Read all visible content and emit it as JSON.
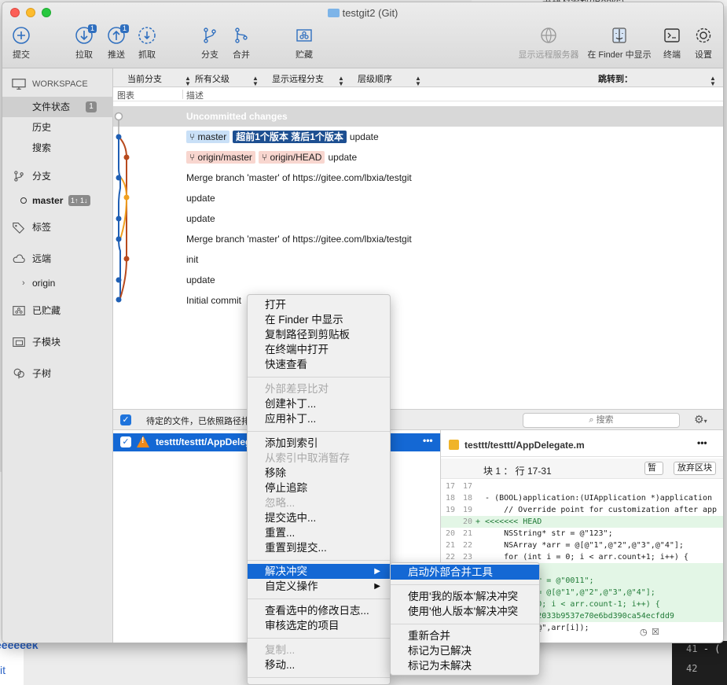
{
  "window": {
    "title": "testgit2 (Git)"
  },
  "background": {
    "top_text": "书籍及资料(iBooks)",
    "left_text": "eeeeeek",
    "left_text2": "it",
    "right_lines": [
      "41",
      "42"
    ],
    "right_char": "- (",
    "left_char": "a"
  },
  "toolbar": {
    "commit": "提交",
    "pull": "拉取",
    "push": "推送",
    "fetch": "抓取",
    "branch": "分支",
    "merge": "合并",
    "stash": "贮藏",
    "show_remote": "显示远程服务器",
    "show_in_finder": "在 Finder 中显示",
    "terminal": "终端",
    "settings": "设置",
    "pull_badge": "1",
    "push_badge": "1"
  },
  "sidebar": {
    "workspace": "WORKSPACE",
    "file_status": "文件状态",
    "file_status_count": "1",
    "history": "历史",
    "search": "搜索",
    "branches": "分支",
    "master": "master",
    "master_badge": "1↑ 1↓",
    "tags": "标签",
    "remotes": "远端",
    "origin": "origin",
    "stashes": "已贮藏",
    "submodules": "子模块",
    "subtrees": "子树"
  },
  "filterbar": {
    "current_branch": "当前分支",
    "all_parents": "所有父级",
    "show_remote_branches": "显示远程分支",
    "ancestor_order": "层级顺序",
    "jump_to": "跳转到："
  },
  "columns": {
    "graph": "图表",
    "description": "描述"
  },
  "commits": [
    {
      "text": "Uncommitted changes",
      "tags": []
    },
    {
      "text": "update",
      "tags": [
        {
          "label": "master",
          "kind": "local"
        },
        {
          "label": "超前1个版本 落后1个版本",
          "kind": "status"
        }
      ]
    },
    {
      "text": "update",
      "tags": [
        {
          "label": "origin/master",
          "kind": "remote"
        },
        {
          "label": "origin/HEAD",
          "kind": "remote"
        }
      ]
    },
    {
      "text": "Merge branch 'master' of https://gitee.com/lbxia/testgit",
      "tags": []
    },
    {
      "text": "update",
      "tags": []
    },
    {
      "text": "update",
      "tags": []
    },
    {
      "text": "Merge branch 'master' of https://gitee.com/lbxia/testgit",
      "tags": []
    },
    {
      "text": "init",
      "tags": []
    },
    {
      "text": "update",
      "tags": []
    },
    {
      "text": "Initial commit",
      "tags": []
    }
  ],
  "staged": {
    "label": "待定的文件，已依照路径排",
    "search_placeholder": "搜索"
  },
  "file": {
    "name": "testtt/testtt/AppDelega"
  },
  "diff": {
    "file": "testtt/testtt/AppDelegate.m",
    "hunk": "块 1 ： 行 17-31",
    "stage_btn": "暂存",
    "discard_btn": "放弃区块",
    "lines": [
      {
        "a": "17",
        "b": "17",
        "t": "",
        "k": "ctx"
      },
      {
        "a": "18",
        "b": "18",
        "t": "  - (BOOL)application:(UIApplication *)application",
        "k": "ctx"
      },
      {
        "a": "19",
        "b": "19",
        "t": "      // Override point for customization after app",
        "k": "ctx"
      },
      {
        "a": "",
        "b": "20",
        "t": "+ <<<<<<< HEAD",
        "k": "add"
      },
      {
        "a": "20",
        "b": "21",
        "t": "      NSString* str = @\"123\";",
        "k": "ctx"
      },
      {
        "a": "21",
        "b": "22",
        "t": "      NSArray *arr = @[@\"1\",@\"2\",@\"3\",@\"4\"];",
        "k": "ctx"
      },
      {
        "a": "22",
        "b": "23",
        "t": "      for (int i = 0; i < arr.count+1; i++) {",
        "k": "ctx"
      },
      {
        "a": "",
        "b": "",
        "t": "",
        "k": "add"
      },
      {
        "a": "",
        "b": "",
        "t": "      ing* str = @\"0011\";",
        "k": "add"
      },
      {
        "a": "",
        "b": "",
        "t": "      y *arr = @[@\"1\",@\"2\",@\"3\",@\"4\"];",
        "k": "add"
      },
      {
        "a": "",
        "b": "",
        "t": "      nt i = 0; i < arr.count-1; i++) {",
        "k": "add"
      },
      {
        "a": "",
        "b": "",
        "t": "    0214019b12033b9537e70e6bd390ca54ecfdd9",
        "k": "add"
      },
      {
        "a": "",
        "b": "",
        "t": "      Log(@\"%@\",arr[i]);",
        "k": "ctx"
      }
    ]
  },
  "context_menu": [
    {
      "label": "打开",
      "state": "normal"
    },
    {
      "label": "在 Finder 中显示",
      "state": "normal"
    },
    {
      "label": "复制路径到剪贴板",
      "state": "normal"
    },
    {
      "label": "在终端中打开",
      "state": "normal"
    },
    {
      "label": "快速查看",
      "state": "normal"
    },
    {
      "label": "外部差异比对",
      "state": "disabled"
    },
    {
      "label": "创建补丁...",
      "state": "normal"
    },
    {
      "label": "应用补丁...",
      "state": "normal"
    },
    {
      "label": "添加到索引",
      "state": "normal"
    },
    {
      "label": "从索引中取消暂存",
      "state": "disabled"
    },
    {
      "label": "移除",
      "state": "normal"
    },
    {
      "label": "停止追踪",
      "state": "normal"
    },
    {
      "label": "忽略...",
      "state": "disabled"
    },
    {
      "label": "提交选中...",
      "state": "normal"
    },
    {
      "label": "重置...",
      "state": "normal"
    },
    {
      "label": "重置到提交...",
      "state": "normal"
    },
    {
      "label": "解决冲突",
      "state": "selected"
    },
    {
      "label": "自定义操作",
      "state": "normal"
    },
    {
      "label": "查看选中的修改日志...",
      "state": "normal"
    },
    {
      "label": "审核选定的项目",
      "state": "normal"
    },
    {
      "label": "复制...",
      "state": "disabled"
    },
    {
      "label": "移动...",
      "state": "normal"
    }
  ],
  "submenu": [
    {
      "label": "启动外部合并工具",
      "state": "selected"
    },
    {
      "label": "使用'我的版本'解决冲突",
      "state": "normal"
    },
    {
      "label": "使用'他人版本'解决冲突",
      "state": "normal"
    },
    {
      "label": "重新合并",
      "state": "normal"
    },
    {
      "label": "标记为已解决",
      "state": "normal"
    },
    {
      "label": "标记为未解决",
      "state": "normal"
    }
  ],
  "colors": {
    "accent": "#1468d4",
    "graph_blue": "#1f5fb4",
    "graph_red": "#b84a1d",
    "graph_orange": "#f0a020",
    "local_tag": "#c9e0f7",
    "remote_tag": "#f8d6cf",
    "status_tag": "#1d4f91"
  }
}
